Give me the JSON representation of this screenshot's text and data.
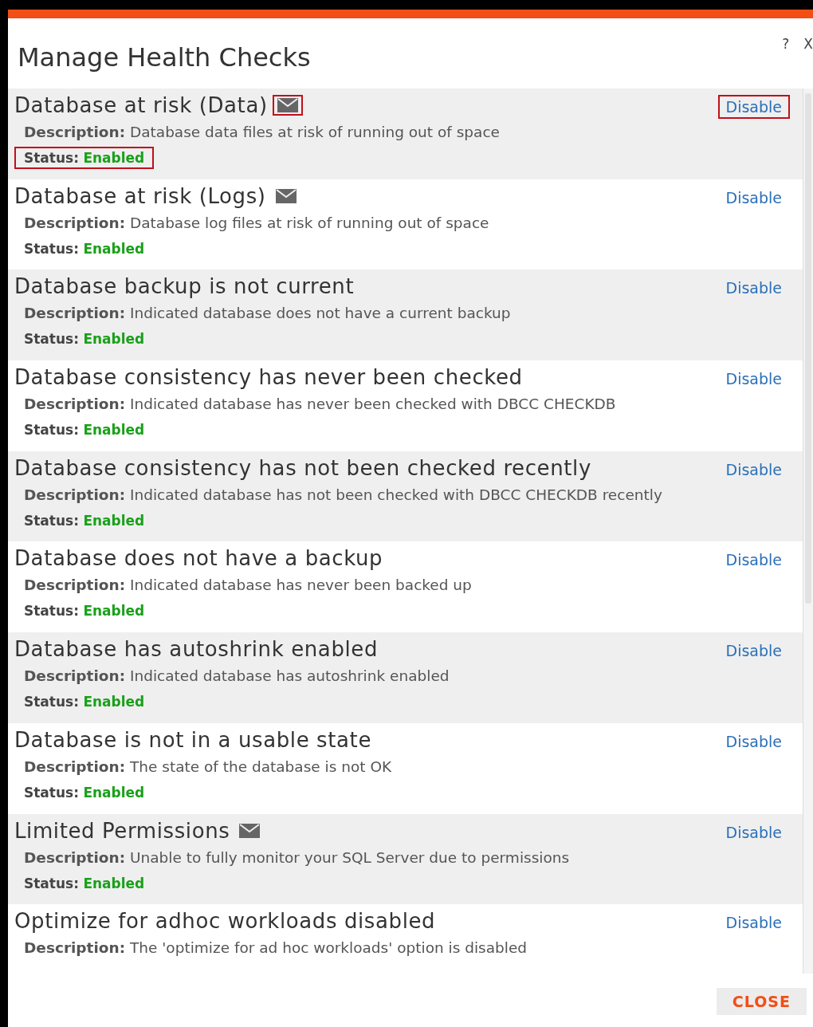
{
  "dialog": {
    "title": "Manage Health Checks",
    "help": "?",
    "close_x": "X"
  },
  "checks": [
    {
      "name": "Database at risk (Data)",
      "mail": true,
      "highlighted": true,
      "action": "Disable",
      "description_label": "Description:",
      "description": "Database data files at risk of running out of space",
      "status_label": "Status:",
      "status": "Enabled"
    },
    {
      "name": "Database at risk (Logs)",
      "mail": true,
      "highlighted": false,
      "action": "Disable",
      "description_label": "Description:",
      "description": "Database log files at risk of running out of space",
      "status_label": "Status:",
      "status": "Enabled"
    },
    {
      "name": "Database backup is not current",
      "mail": false,
      "highlighted": false,
      "action": "Disable",
      "description_label": "Description:",
      "description": "Indicated database does not have a current backup",
      "status_label": "Status:",
      "status": "Enabled"
    },
    {
      "name": "Database consistency has never been checked",
      "mail": false,
      "highlighted": false,
      "action": "Disable",
      "description_label": "Description:",
      "description": "Indicated database has never been checked with DBCC CHECKDB",
      "status_label": "Status:",
      "status": "Enabled"
    },
    {
      "name": "Database consistency has not been checked recently",
      "mail": false,
      "highlighted": false,
      "action": "Disable",
      "description_label": "Description:",
      "description": "Indicated database has not been checked with DBCC CHECKDB recently",
      "status_label": "Status:",
      "status": "Enabled"
    },
    {
      "name": "Database does not have a backup",
      "mail": false,
      "highlighted": false,
      "action": "Disable",
      "description_label": "Description:",
      "description": "Indicated database has never been backed up",
      "status_label": "Status:",
      "status": "Enabled"
    },
    {
      "name": "Database has autoshrink enabled",
      "mail": false,
      "highlighted": false,
      "action": "Disable",
      "description_label": "Description:",
      "description": "Indicated database has autoshrink enabled",
      "status_label": "Status:",
      "status": "Enabled"
    },
    {
      "name": "Database is not in a usable state",
      "mail": false,
      "highlighted": false,
      "action": "Disable",
      "description_label": "Description:",
      "description": "The state of the database is not OK",
      "status_label": "Status:",
      "status": "Enabled"
    },
    {
      "name": "Limited Permissions",
      "mail": true,
      "highlighted": false,
      "action": "Disable",
      "description_label": "Description:",
      "description": "Unable to fully monitor your SQL Server due to permissions",
      "status_label": "Status:",
      "status": "Enabled"
    },
    {
      "name": "Optimize for adhoc workloads disabled",
      "mail": false,
      "highlighted": false,
      "action": "Disable",
      "description_label": "Description:",
      "description": "The 'optimize for ad hoc workloads' option is disabled"
    }
  ],
  "footer": {
    "button": "CLOSE"
  }
}
